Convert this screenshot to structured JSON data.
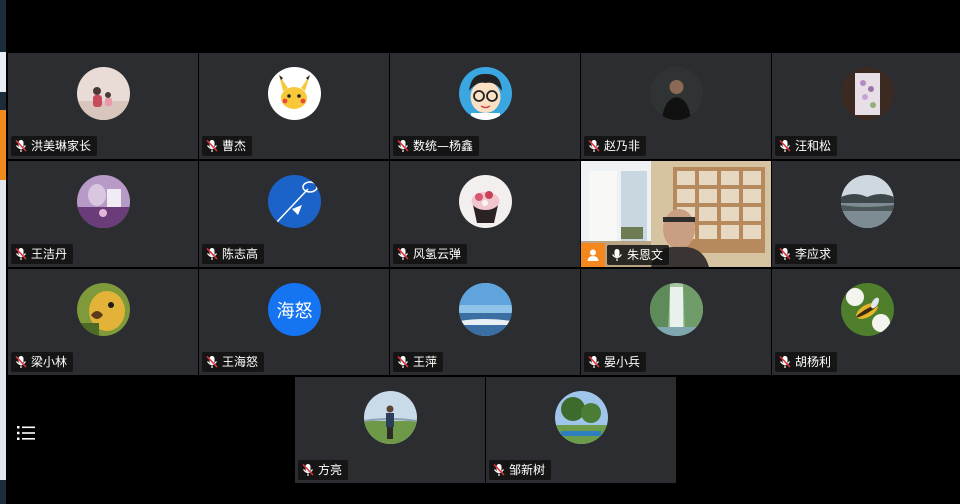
{
  "participants": [
    {
      "name": "洪美琳家长",
      "avatar_icon": "photo-woman-child-avatar",
      "muted": true
    },
    {
      "name": "曹杰",
      "avatar_icon": "cartoon-pikachu-avatar",
      "muted": true
    },
    {
      "name": "数统—杨鑫",
      "avatar_icon": "cartoon-boy-glasses-avatar",
      "muted": true
    },
    {
      "name": "赵乃非",
      "avatar_icon": "photo-man-avatar",
      "muted": true
    },
    {
      "name": "汪和松",
      "avatar_icon": "photo-flowers-avatar",
      "muted": true
    },
    {
      "name": "王洁丹",
      "avatar_icon": "photo-purple-room-avatar",
      "muted": true
    },
    {
      "name": "陈志高",
      "avatar_icon": "badminton-avatar",
      "muted": true
    },
    {
      "name": "风氢云弹",
      "avatar_icon": "cupcake-avatar",
      "muted": true
    },
    {
      "name": "朱恩文",
      "avatar_icon": "live-video",
      "muted": false,
      "is_host": true
    },
    {
      "name": "李应求",
      "avatar_icon": "lake-landscape-avatar",
      "muted": true
    },
    {
      "name": "梁小林",
      "avatar_icon": "parrot-avatar",
      "muted": true
    },
    {
      "name": "王海怒",
      "avatar_text": "海怒",
      "muted": true
    },
    {
      "name": "王萍",
      "avatar_icon": "sea-horizon-avatar",
      "muted": true
    },
    {
      "name": "晏小兵",
      "avatar_icon": "waterfall-avatar",
      "muted": true
    },
    {
      "name": "胡杨利",
      "avatar_icon": "insect-flower-avatar",
      "muted": true
    },
    {
      "name": "方亮",
      "avatar_icon": "photo-person-outdoor-avatar",
      "muted": true
    },
    {
      "name": "邹新树",
      "avatar_icon": "trees-park-avatar",
      "muted": true
    }
  ],
  "colors": {
    "tile_bg": "#2b2d30",
    "name_tag_bg": "#121212",
    "host_badge": "#f5871f",
    "text_avatar_bg": "#1574f2"
  },
  "controls": {
    "menu_icon": "list-menu-icon"
  }
}
